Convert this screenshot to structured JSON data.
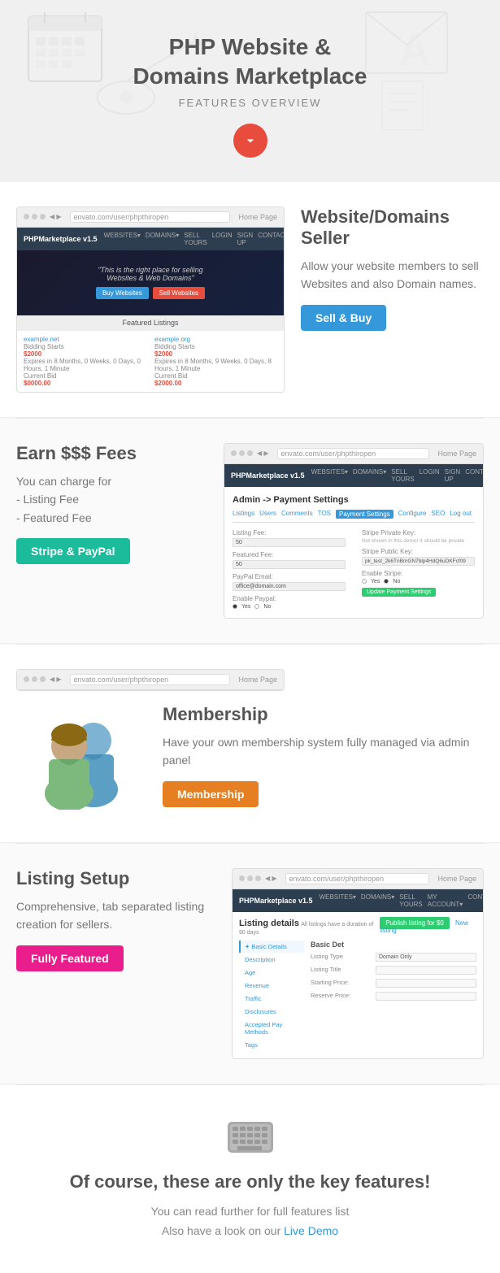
{
  "hero": {
    "title": "PHP Website &\nDomains Marketplace",
    "subtitle": "FEATURES OVERVIEW",
    "arrow_label": "scroll down"
  },
  "features": {
    "seller": {
      "title": "Website/Domains Seller",
      "description": "Allow your website members to sell Websites and also Domain names.",
      "button_label": "Sell & Buy",
      "button_type": "blue",
      "mock_logo": "PHPMarketplace v1.5",
      "mock_nav": [
        "WEBSITES▾",
        "DOMAINS▾",
        "SELL YOURS",
        "LOGIN",
        "SIGN UP",
        "CONTACT"
      ],
      "mock_tagline": "\"This is the right place for selling Websites & Web Domains\"",
      "mock_btn1": "Buy Websites",
      "mock_btn2": "Sell Websites",
      "mock_featured_label": "Featured Listings",
      "listings": [
        {
          "link": "example.net",
          "bids_label": "Bidding Starts",
          "bids_value": "$2000",
          "expires": "Expires in 8 Months, 0 Weeks, 0 Days, 0 Hours, 1 Minute",
          "current_label": "Current Bid",
          "current_value": "$0000.00"
        },
        {
          "link": "example.org",
          "bids_label": "Bidding Starts",
          "bids_value": "$2000",
          "expires": "Expires in 8 Months, 9 Weeks, 0 Days, 8 Hours, 1 Minute",
          "current_label": "Current Bid",
          "current_value": "$2000.00"
        }
      ]
    },
    "fees": {
      "title": "Earn $$$ Fees",
      "description": "You can charge for\n- Listing Fee\n- Featured Fee",
      "button_label": "Stripe & PayPal",
      "button_type": "teal",
      "admin_title": "Admin -> Payment Settings",
      "admin_nav": [
        "Listings",
        "Users",
        "Comments",
        "TOS",
        "Payment Settings",
        "Configure",
        "SEO",
        "Log out"
      ],
      "active_nav": "Payment Settings",
      "fields_left": [
        {
          "label": "Listing Fee:",
          "value": "50"
        },
        {
          "label": "Featured Fee:",
          "value": "50"
        },
        {
          "label": "PayPal Email:",
          "value": "office@domain.com"
        },
        {
          "label": "Enable Paypal:",
          "radio": [
            "Yes",
            "No"
          ]
        }
      ],
      "fields_right": [
        {
          "label": "Stripe Private Key:",
          "note": "Not shown in this demo! It should be private"
        },
        {
          "label": "Stripe Public Key:",
          "value": "pk_test_2k6TnBmGN7blp4HdQ6uDKFcf09"
        },
        {
          "label": "Enable Stripe:",
          "radio": [
            "Yes",
            "No"
          ],
          "selected": "No"
        },
        {
          "btn": "Update Payment Settings"
        }
      ]
    },
    "membership": {
      "title": "Membership",
      "description": "Have your own membership system fully managed via admin panel",
      "button_label": "Membership",
      "button_type": "orange"
    },
    "listing_setup": {
      "title": "Listing Setup",
      "description": "Comprehensive, tab separated listing creation for sellers.",
      "button_label": "Fully Featured",
      "button_type": "pink",
      "admin_logo": "PHPMarketplace v1.5",
      "admin_nav": [
        "WEBSITES▾",
        "DOMAINS▾",
        "SELL YOURS",
        "MY ACCOUNT▾",
        "CONTACT"
      ],
      "mock_title": "Listing details",
      "mock_subtitle": "All listings have a duration of 90 days",
      "publish_btn": "Publish listing for $0",
      "new_listing_btn": "New listing",
      "tabs": [
        "Basic Details",
        "Description",
        "Age",
        "Revenue",
        "Traffic",
        "Disclosures",
        "Accepted Pay Methods",
        "Tags"
      ],
      "active_tab": "Basic Details",
      "form_fields": [
        {
          "label": "Listing Type",
          "options": [
            "Domain Only"
          ]
        },
        {
          "label": "Listing Title",
          "value": ""
        },
        {
          "label": "Starting Price:",
          "value": ""
        },
        {
          "label": "Reserve Price:",
          "value": ""
        }
      ]
    }
  },
  "bottom": {
    "icon": "keyboard",
    "heading": "Of course, these are only the key features!",
    "line1": "You can read further for full features list",
    "line2": "Also have a look on our Live Demo"
  }
}
